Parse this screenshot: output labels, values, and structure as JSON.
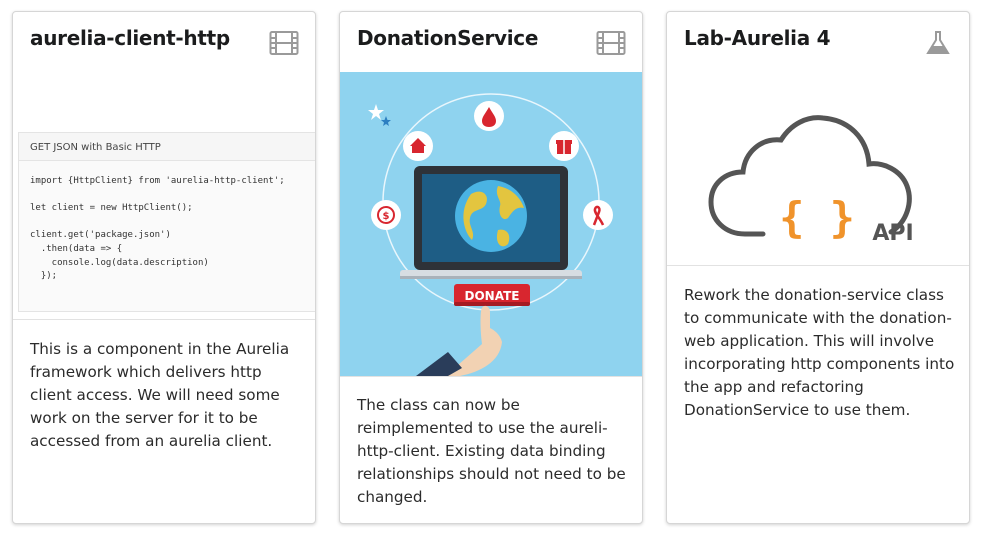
{
  "cards": [
    {
      "title": "aurelia-client-http",
      "icon": "film-icon",
      "code_header": "GET JSON with Basic HTTP",
      "code_lines": [
        "import {HttpClient} from 'aurelia-http-client';",
        "",
        "let client = new HttpClient();",
        "",
        "client.get('package.json')",
        "  .then(data => {",
        "    console.log(data.description)",
        "  });"
      ],
      "description": "This is a component in the Aurelia framework which delivers http client access. We will need some work on the server for it to be accessed from an aurelia client."
    },
    {
      "title": "DonationService",
      "icon": "film-icon",
      "donate_label": "DONATE",
      "description": "The class can now be reimplemented to use the aureli-http-client. Existing data binding relationships should not need to be changed."
    },
    {
      "title": "Lab-Aurelia 4",
      "icon": "flask-icon",
      "api_label": "API",
      "braces_label": "{ }",
      "description": "Rework the donation-service class to communicate with the donation-web application. This will involve incorporating http components into the app and refactoring DonationService to use them."
    }
  ],
  "colors": {
    "illustration_bg": "#8fd3ef",
    "donate_red": "#d8262f",
    "braces_orange": "#f0932b",
    "cloud_gray": "#555555"
  }
}
